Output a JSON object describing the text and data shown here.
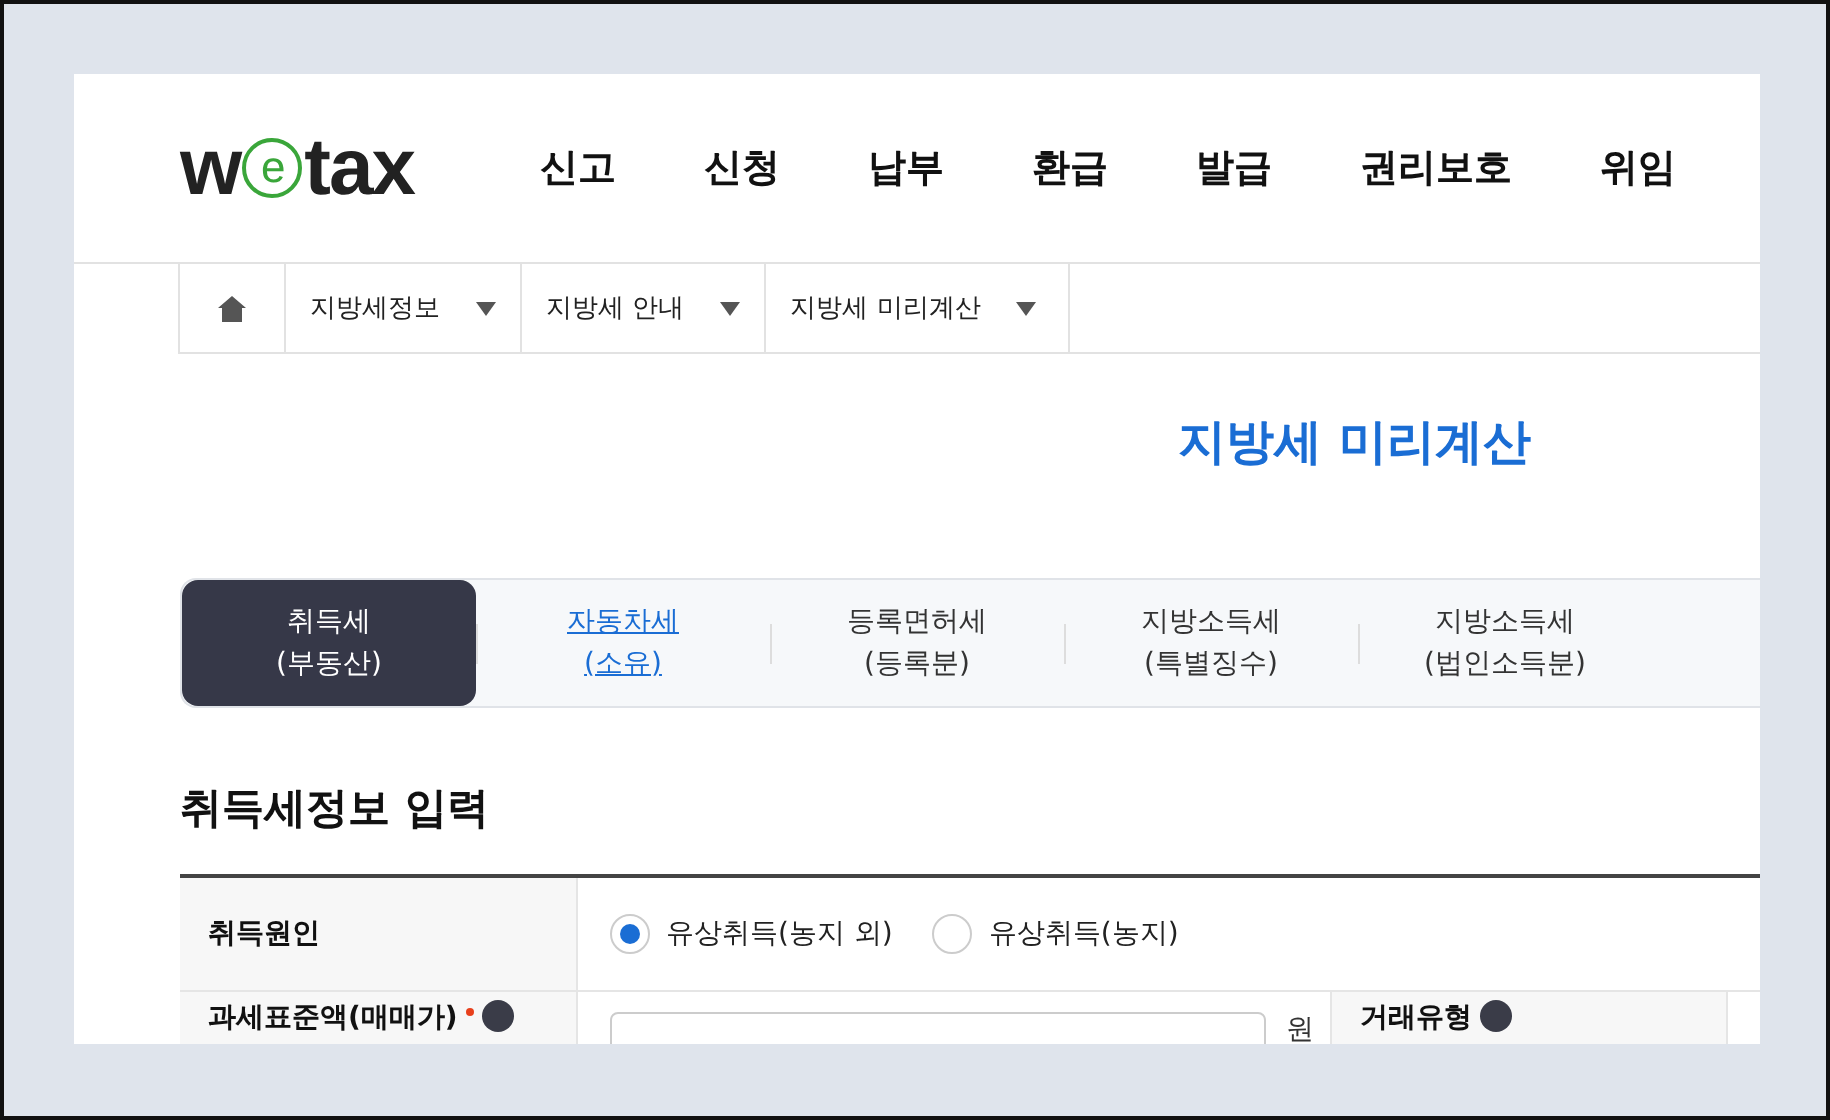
{
  "header": {
    "logo": {
      "before": "w",
      "circled": "e",
      "after": "tax"
    },
    "nav": [
      "신고",
      "신청",
      "납부",
      "환급",
      "발급",
      "권리보호",
      "위임"
    ]
  },
  "breadcrumb": [
    "지방세정보",
    "지방세 안내",
    "지방세 미리계산"
  ],
  "page_title": "지방세 미리계산",
  "tabs": [
    {
      "line1": "취득세",
      "line2": "(부동산)",
      "selected": true,
      "highlighted": false
    },
    {
      "line1": "자동차세",
      "line2": "(소유)",
      "selected": false,
      "highlighted": true
    },
    {
      "line1": "등록면허세",
      "line2": "(등록분)",
      "selected": false,
      "highlighted": false
    },
    {
      "line1": "지방소득세",
      "line2": "(특별징수)",
      "selected": false,
      "highlighted": false
    },
    {
      "line1": "지방소득세",
      "line2": "(법인소득분)",
      "selected": false,
      "highlighted": false
    }
  ],
  "section_title": "취득세정보 입력",
  "form": {
    "cause_label": "취득원인",
    "options": [
      {
        "label": "유상취득(농지 외)",
        "selected": true
      },
      {
        "label": "유상취득(농지)",
        "selected": false
      }
    ],
    "amount_label": "과세표준액(매매가)",
    "amount_required": true,
    "amount_unit": "원",
    "trade_label": "거래유형"
  }
}
